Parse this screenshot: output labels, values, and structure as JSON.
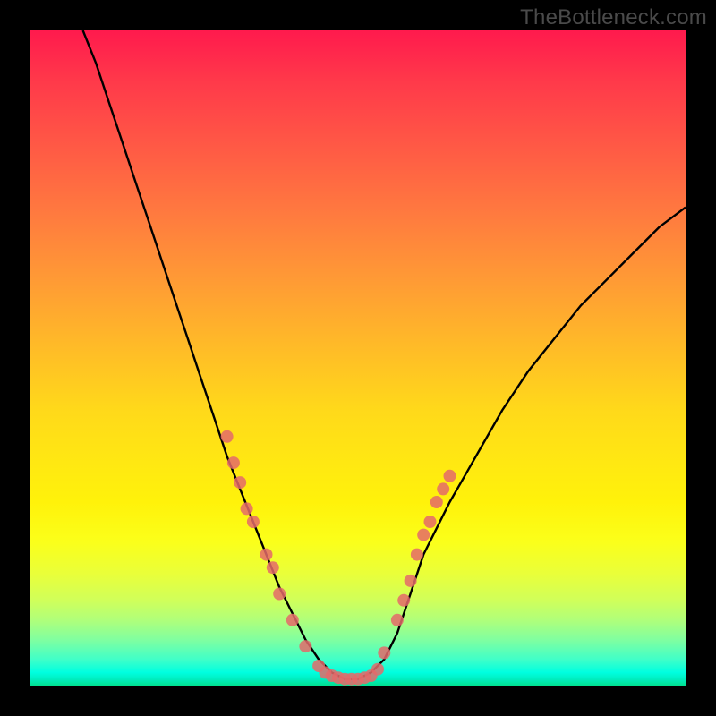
{
  "watermark": "TheBottleneck.com",
  "chart_data": {
    "type": "line",
    "title": "",
    "xlabel": "",
    "ylabel": "",
    "xlim": [
      0,
      100
    ],
    "ylim": [
      0,
      100
    ],
    "series": [
      {
        "name": "bottleneck-curve",
        "x": [
          8,
          10,
          12,
          14,
          16,
          18,
          20,
          22,
          24,
          26,
          28,
          30,
          32,
          34,
          36,
          38,
          40,
          42,
          44,
          46,
          48,
          50,
          52,
          54,
          56,
          58,
          60,
          64,
          68,
          72,
          76,
          80,
          84,
          88,
          92,
          96,
          100
        ],
        "y": [
          100,
          95,
          89,
          83,
          77,
          71,
          65,
          59,
          53,
          47,
          41,
          35,
          30,
          25,
          20,
          15,
          11,
          7,
          4,
          2,
          1,
          1,
          2,
          4,
          8,
          14,
          20,
          28,
          35,
          42,
          48,
          53,
          58,
          62,
          66,
          70,
          73
        ]
      }
    ],
    "markers": [
      {
        "x": 30,
        "y": 38
      },
      {
        "x": 31,
        "y": 34
      },
      {
        "x": 32,
        "y": 31
      },
      {
        "x": 33,
        "y": 27
      },
      {
        "x": 34,
        "y": 25
      },
      {
        "x": 36,
        "y": 20
      },
      {
        "x": 37,
        "y": 18
      },
      {
        "x": 38,
        "y": 14
      },
      {
        "x": 40,
        "y": 10
      },
      {
        "x": 42,
        "y": 6
      },
      {
        "x": 44,
        "y": 3
      },
      {
        "x": 45,
        "y": 2
      },
      {
        "x": 46,
        "y": 1.5
      },
      {
        "x": 47,
        "y": 1.2
      },
      {
        "x": 48,
        "y": 1
      },
      {
        "x": 49,
        "y": 1
      },
      {
        "x": 50,
        "y": 1
      },
      {
        "x": 51,
        "y": 1.2
      },
      {
        "x": 52,
        "y": 1.5
      },
      {
        "x": 53,
        "y": 2.5
      },
      {
        "x": 54,
        "y": 5
      },
      {
        "x": 56,
        "y": 10
      },
      {
        "x": 57,
        "y": 13
      },
      {
        "x": 58,
        "y": 16
      },
      {
        "x": 59,
        "y": 20
      },
      {
        "x": 60,
        "y": 23
      },
      {
        "x": 61,
        "y": 25
      },
      {
        "x": 62,
        "y": 28
      },
      {
        "x": 63,
        "y": 30
      },
      {
        "x": 64,
        "y": 32
      }
    ],
    "marker_color": "#e46a6a",
    "curve_color": "#000000"
  }
}
